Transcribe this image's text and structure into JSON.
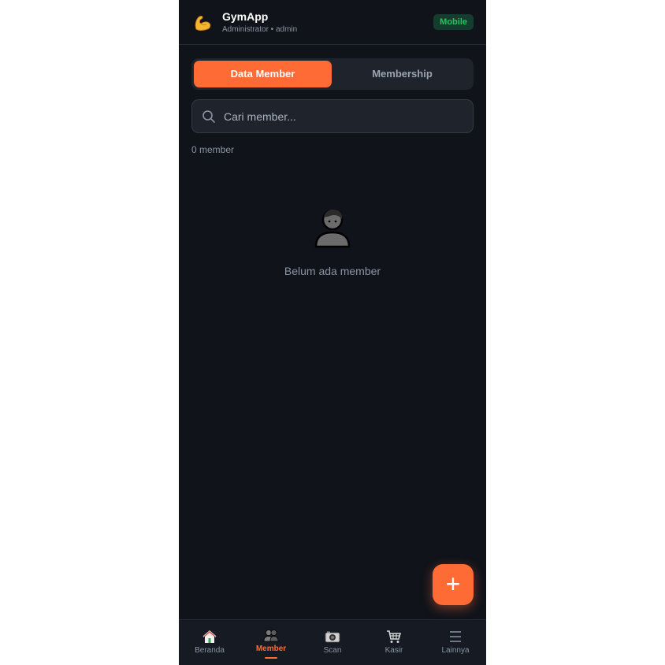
{
  "app": {
    "name": "GymApp",
    "subtitle": "Administrator • admin",
    "mode_badge": "Mobile",
    "logo_icon": "flexed-biceps-icon"
  },
  "tabs": [
    {
      "label": "Data Member",
      "active": true
    },
    {
      "label": "Membership",
      "active": false
    }
  ],
  "search": {
    "placeholder": "Cari member...",
    "value": ""
  },
  "member_count": "0 member",
  "empty_state": {
    "icon": "person-silhouette-icon",
    "text": "Belum ada member"
  },
  "fab": {
    "label": "+",
    "icon": "plus-icon"
  },
  "bottom_nav": [
    {
      "label": "Beranda",
      "icon": "house-icon",
      "active": false
    },
    {
      "label": "Member",
      "icon": "people-icon",
      "active": true
    },
    {
      "label": "Scan",
      "icon": "camera-icon",
      "active": false
    },
    {
      "label": "Kasir",
      "icon": "shopping-cart-icon",
      "active": false
    },
    {
      "label": "Lainnya",
      "icon": "hamburger-menu-icon",
      "active": false
    }
  ],
  "colors": {
    "accent": "#ff6b35",
    "background": "#10131a",
    "badge_text": "#22c55e",
    "muted_text": "#8a94a3"
  }
}
